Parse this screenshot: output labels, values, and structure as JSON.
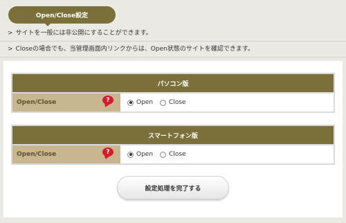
{
  "header": {
    "title": "Open/Close設定"
  },
  "notices": [
    {
      "arrow": ">",
      "text": "サイトを一般には非公開にすることができます。"
    },
    {
      "arrow": ">",
      "text": "Closeの場合でも、当管理画面内リンクからは、Open状態のサイトを確認できます。"
    }
  ],
  "sections": [
    {
      "heading": "パソコン版",
      "row_label": "Open/Close",
      "help": "?",
      "options": [
        {
          "label": "Open",
          "checked": true
        },
        {
          "label": "Close",
          "checked": false
        }
      ]
    },
    {
      "heading": "スマートフォン版",
      "row_label": "Open/Close",
      "help": "?",
      "options": [
        {
          "label": "Open",
          "checked": true
        },
        {
          "label": "Close",
          "checked": false
        }
      ]
    }
  ],
  "actions": {
    "submit_label": "設定処理を完了する"
  },
  "colors": {
    "accent": "#7b6f3a",
    "label_bg": "#c9b58f",
    "help": "#d61c2c"
  }
}
